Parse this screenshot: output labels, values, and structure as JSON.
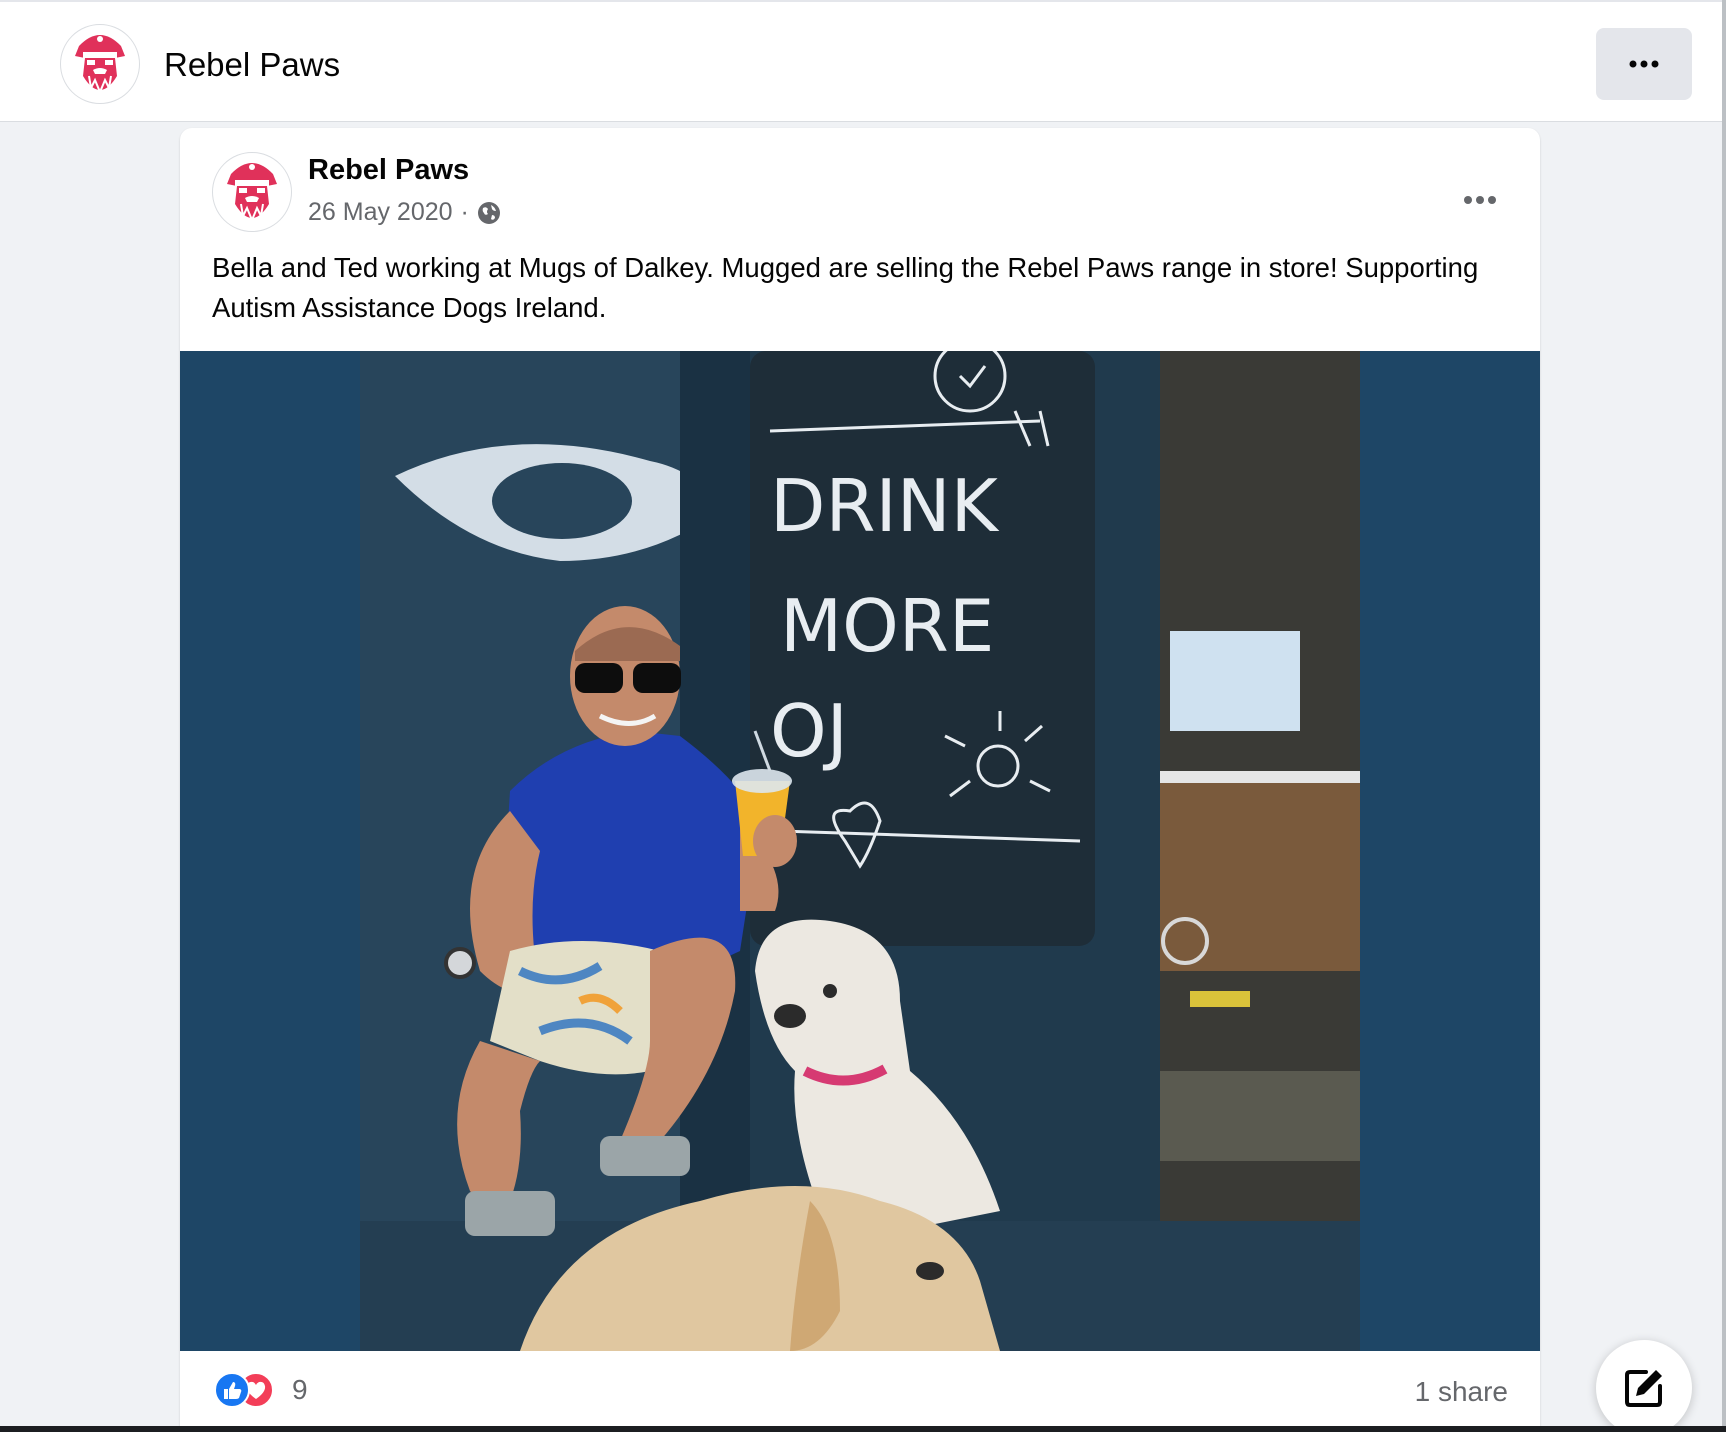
{
  "header": {
    "page_name": "Rebel Paws",
    "more_icon": "more-horizontal-icon"
  },
  "post": {
    "author": "Rebel Paws",
    "date": "26 May 2020",
    "separator": "·",
    "privacy_icon": "globe-icon",
    "text": "Bella and Ted working at Mugs of Dalkey. Mugged are selling the Rebel Paws range in store! Supporting Autism Assistance Dogs Ireland.",
    "photo": {
      "chalkboard_lines": [
        "DRINK",
        "MORE",
        "OJ"
      ]
    },
    "reactions": {
      "icons": [
        "like-reaction-icon",
        "love-reaction-icon"
      ],
      "count": "9"
    },
    "shares": "1 share"
  },
  "compose_icon": "compose-icon",
  "colors": {
    "brand_red": "#e0315a",
    "photo_bg": "#1e4666",
    "like_blue": "#1877f2",
    "love_red": "#f33e58"
  }
}
